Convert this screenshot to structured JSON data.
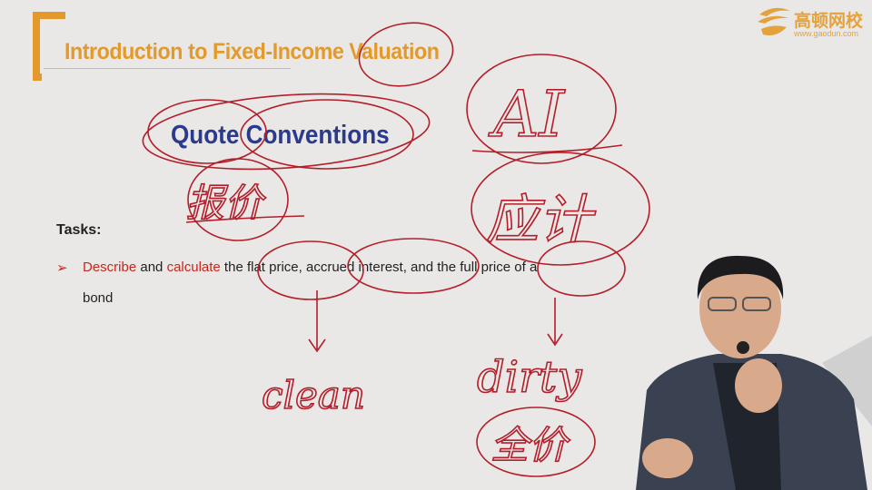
{
  "slide": {
    "title": "Introduction to Fixed-Income Valuation",
    "subtitle": "Quote Conventions",
    "tasks_label": "Tasks:",
    "bullet_marker": "➢",
    "task": {
      "word1": "Describe",
      "word2": " and ",
      "word3": "calculate",
      "rest": " the flat price, accrued interest, and the full price of a",
      "line2": "bond"
    }
  },
  "logo": {
    "chinese": "高顿网校",
    "url": "www.gaodun.com"
  },
  "annotations": {
    "ai": "AI",
    "baojia": "报价",
    "yingji": "应计",
    "clean": "clean",
    "dirty": "dirty",
    "quanjia": "全价"
  },
  "colors": {
    "title": "#e39a2a",
    "subtitle": "#2b3a8c",
    "ink": "#b41e2a",
    "highlight": "#c9261c"
  }
}
